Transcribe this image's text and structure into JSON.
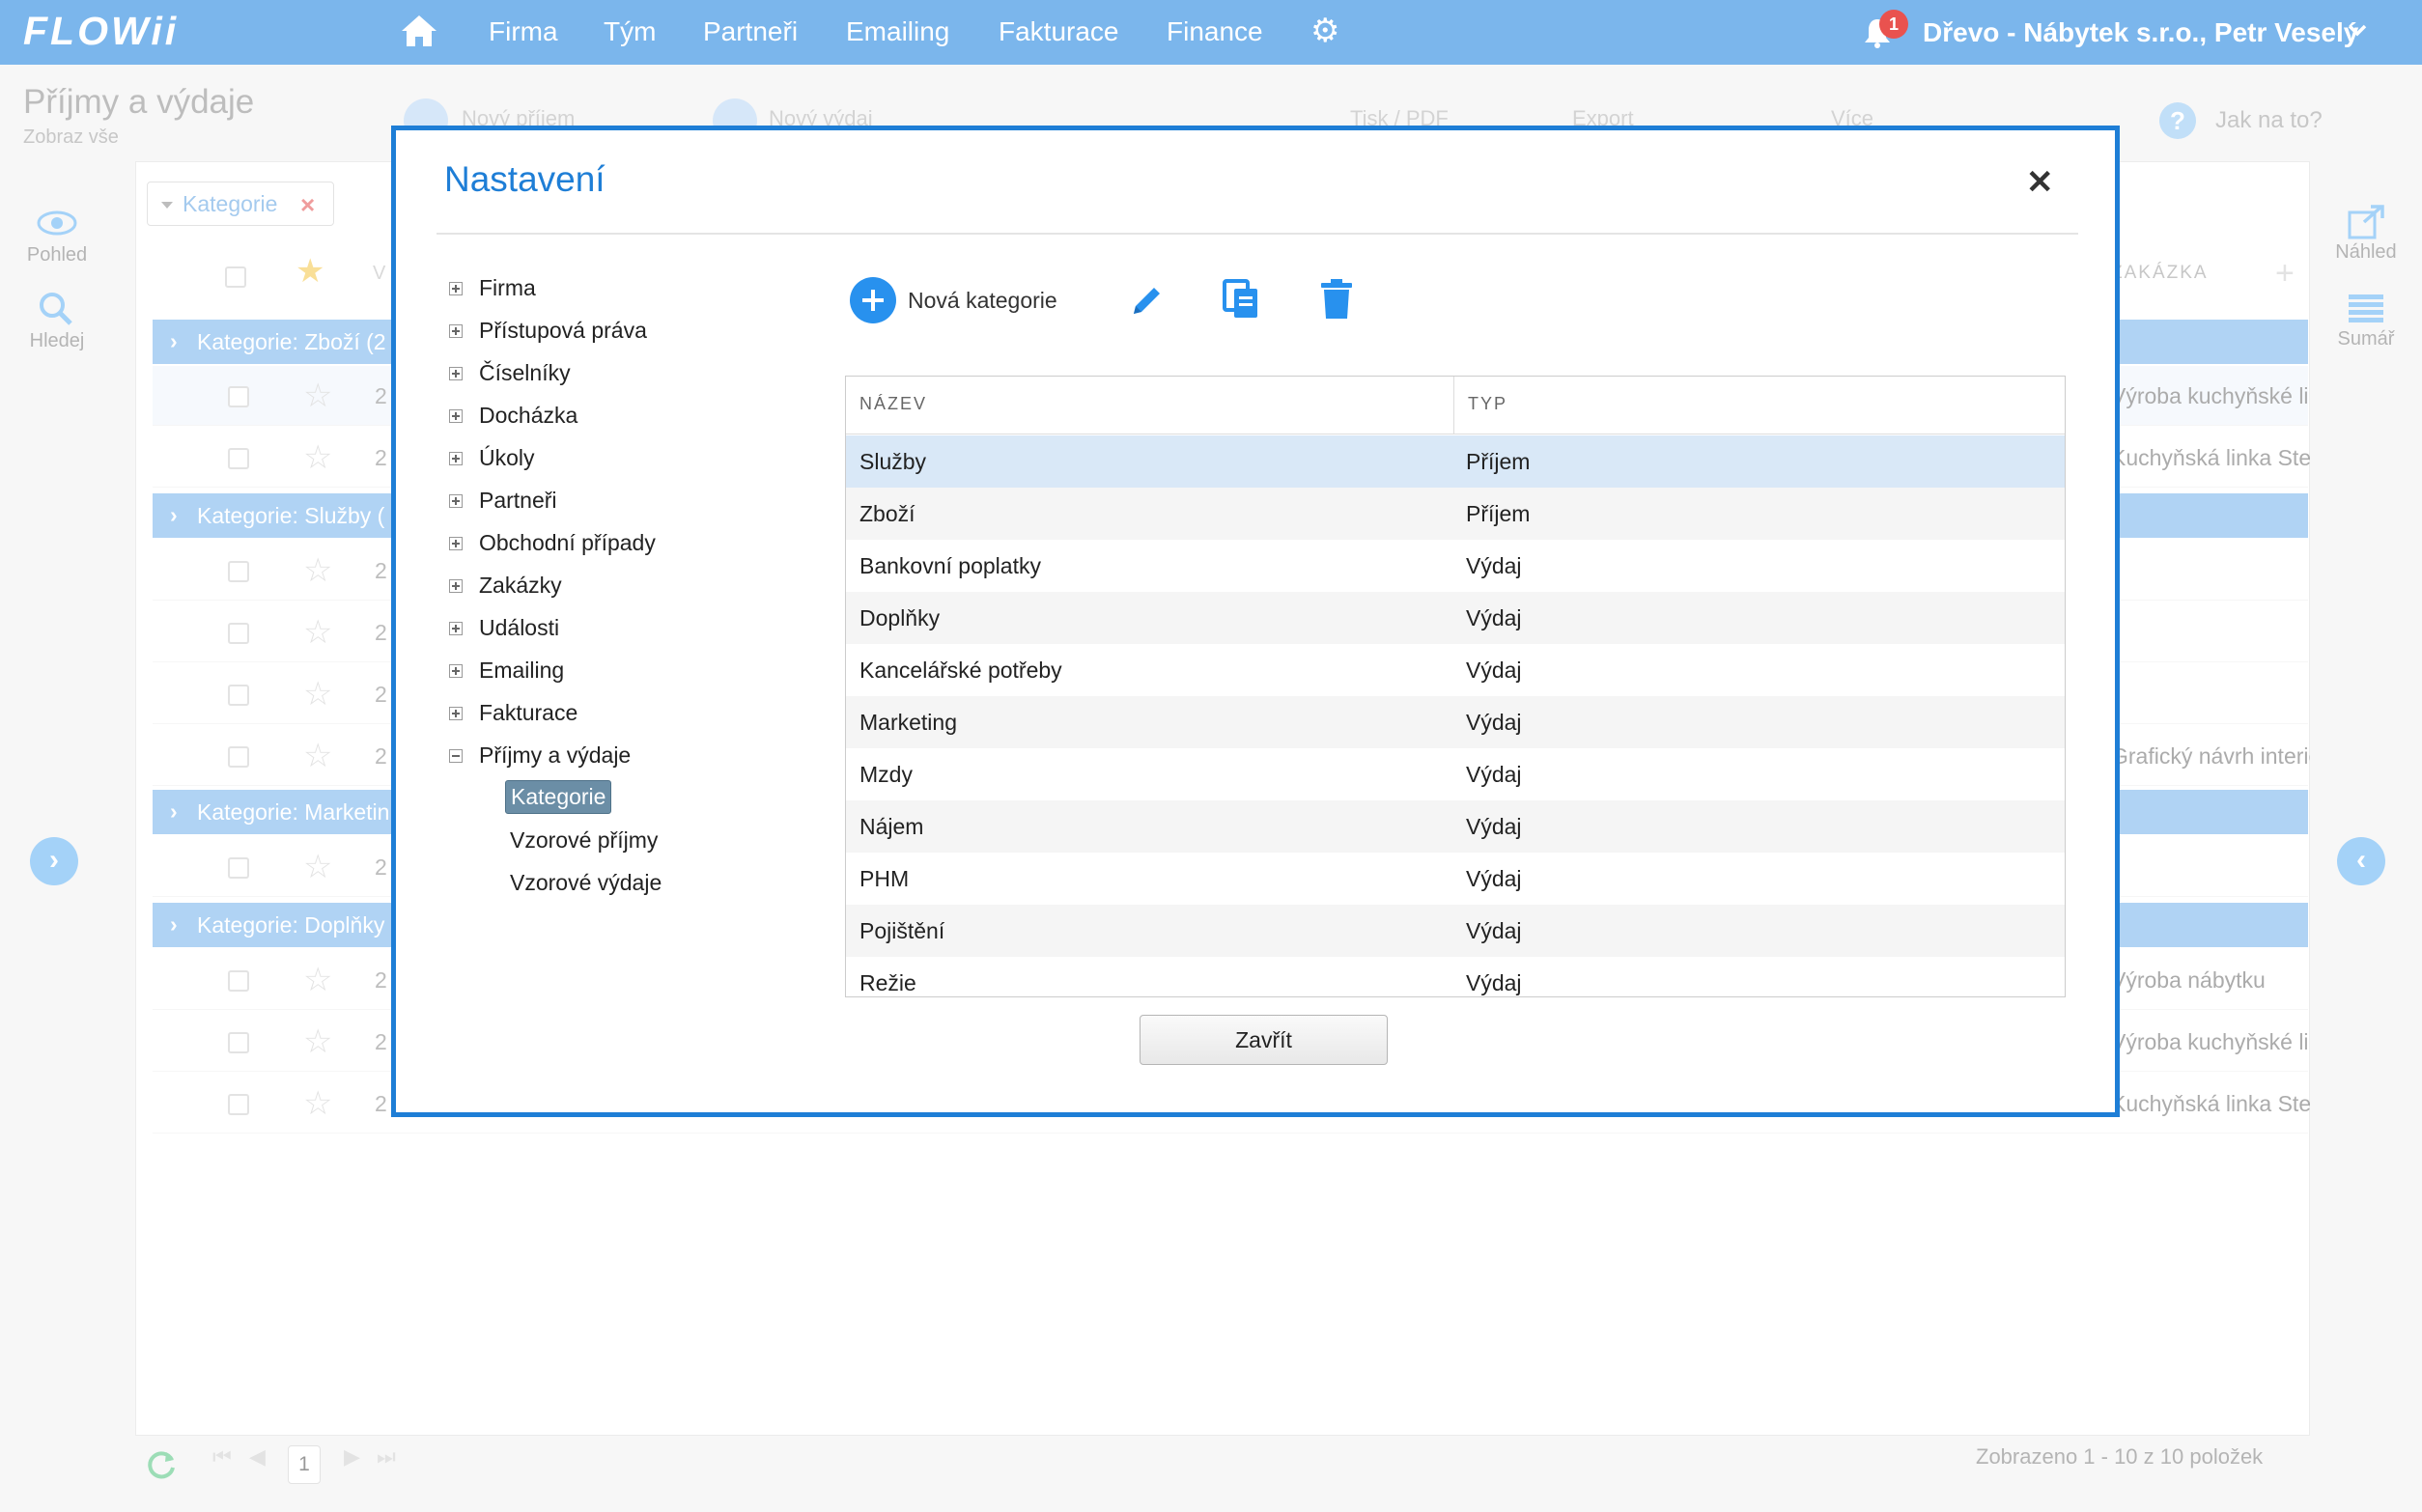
{
  "app": {
    "logo": "FLOWii",
    "nav": [
      "Firma",
      "Tým",
      "Partneři",
      "Emailing",
      "Fakturace",
      "Finance"
    ],
    "notification_count": "1",
    "company_user": "Dřevo - Nábytek s.r.o., Petr Veselý"
  },
  "page": {
    "title": "Příjmy a výdaje",
    "subtitle": "Zobraz vše",
    "toolbar": {
      "new_income": "Nový příjem",
      "new_expense": "Nový výdaj",
      "print": "Tisk / PDF",
      "export": "Export",
      "more": "Více",
      "help": "Jak na to?"
    },
    "filter_tag": "Kategorie",
    "left_panel": {
      "view": "Pohled",
      "search": "Hledej"
    },
    "right_panel": {
      "preview": "Náhled",
      "summary": "Sumář"
    },
    "column_header_right": "ZAKÁZKA",
    "column_header_left": "V",
    "groups": [
      "Kategorie: Zboží (2",
      "Kategorie: Služby (",
      "Kategorie: Marketin",
      "Kategorie: Doplňky"
    ],
    "rows": [
      {
        "num": "2",
        "right": "Výroba kuchyňské linky"
      },
      {
        "num": "2",
        "right": "Kuchyňská linka Stela"
      },
      {
        "num": "2",
        "right": ""
      },
      {
        "num": "2",
        "right": ""
      },
      {
        "num": "2",
        "right": ""
      },
      {
        "num": "2",
        "right": "Grafický návrh interiéru"
      },
      {
        "num": "2",
        "right": ""
      },
      {
        "num": "2",
        "right": "Výroba nábytku"
      },
      {
        "num": "2",
        "right": "Výroba kuchyňské linky"
      },
      {
        "num": "2",
        "right": "Kuchyňská linka Stela"
      }
    ],
    "pager": {
      "page": "1",
      "summary": "Zobrazeno 1 - 10 z 10 položek"
    }
  },
  "modal": {
    "title": "Nastavení",
    "tree": [
      {
        "label": "Firma",
        "expanded": false
      },
      {
        "label": "Přístupová práva",
        "expanded": false
      },
      {
        "label": "Číselníky",
        "expanded": false
      },
      {
        "label": "Docházka",
        "expanded": false
      },
      {
        "label": "Úkoly",
        "expanded": false
      },
      {
        "label": "Partneři",
        "expanded": false
      },
      {
        "label": "Obchodní případy",
        "expanded": false
      },
      {
        "label": "Zakázky",
        "expanded": false
      },
      {
        "label": "Události",
        "expanded": false
      },
      {
        "label": "Emailing",
        "expanded": false
      },
      {
        "label": "Fakturace",
        "expanded": false
      },
      {
        "label": "Příjmy a výdaje",
        "expanded": true
      }
    ],
    "subtree": [
      "Kategorie",
      "Vzorové příjmy",
      "Vzorové výdaje"
    ],
    "selected_subtree": "Kategorie",
    "new_category_label": "Nová kategorie",
    "columns": [
      "NÁZEV",
      "TYP"
    ],
    "categories": [
      {
        "name": "Služby",
        "type": "Příjem"
      },
      {
        "name": "Zboží",
        "type": "Příjem"
      },
      {
        "name": "Bankovní poplatky",
        "type": "Výdaj"
      },
      {
        "name": "Doplňky",
        "type": "Výdaj"
      },
      {
        "name": "Kancelářské potřeby",
        "type": "Výdaj"
      },
      {
        "name": "Marketing",
        "type": "Výdaj"
      },
      {
        "name": "Mzdy",
        "type": "Výdaj"
      },
      {
        "name": "Nájem",
        "type": "Výdaj"
      },
      {
        "name": "PHM",
        "type": "Výdaj"
      },
      {
        "name": "Pojištění",
        "type": "Výdaj"
      },
      {
        "name": "Režie",
        "type": "Výdaj"
      }
    ],
    "close_label": "Zavřít"
  },
  "colors": {
    "topbar": "#7bb6ec",
    "accent": "#1e7ed6",
    "group_row": "#6fb0ec",
    "selected_row": "#d9e8f7",
    "striped_row": "#f5f5f5"
  },
  "icons": {
    "home": "home-icon",
    "gear": "gear-icon",
    "bell": "bell-icon",
    "eye": "eye-icon",
    "search": "search-icon",
    "external": "external-link-icon",
    "list": "list-icon",
    "pencil": "pencil-icon",
    "copy": "copy-icon",
    "trash": "trash-icon",
    "refresh": "refresh-icon"
  }
}
